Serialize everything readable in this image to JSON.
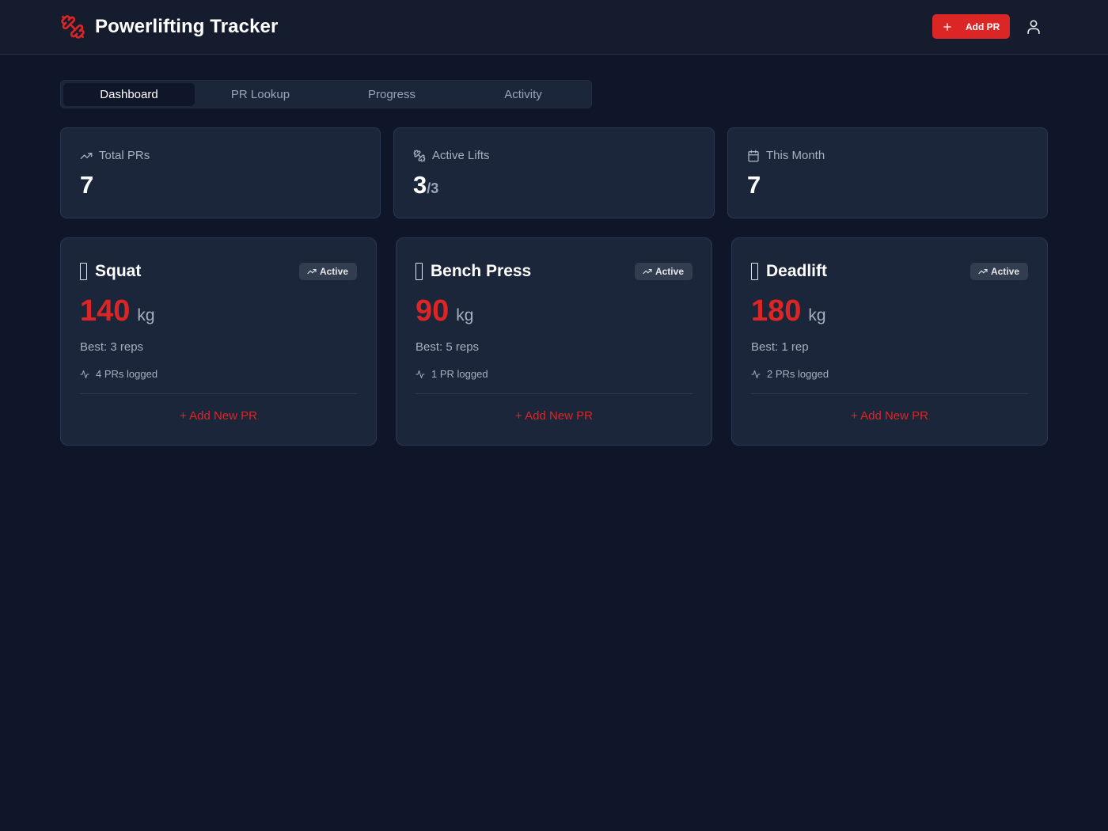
{
  "app": {
    "title": "Powerlifting Tracker",
    "add_pr_label": "Add PR",
    "accent_color": "#dc2626",
    "brand_icon": "dumbbell-icon",
    "user_icon": "user-icon"
  },
  "tabs": [
    {
      "label": "Dashboard",
      "active": true
    },
    {
      "label": "PR Lookup",
      "active": false
    },
    {
      "label": "Progress",
      "active": false
    },
    {
      "label": "Activity",
      "active": false
    }
  ],
  "stats": [
    {
      "label": "Total PRs",
      "value": "7",
      "sub": "",
      "icon": "trending-up-icon"
    },
    {
      "label": "Active Lifts",
      "value": "3",
      "sub": "/3",
      "icon": "dumbbell-icon"
    },
    {
      "label": "This Month",
      "value": "7",
      "sub": "",
      "icon": "calendar-icon"
    }
  ],
  "lifts": [
    {
      "name": "Squat",
      "status": "Active",
      "weight": "140",
      "unit": "kg",
      "best": "Best: 3 reps",
      "count": "4 PRs logged",
      "action": "+ Add New PR"
    },
    {
      "name": "Bench Press",
      "status": "Active",
      "weight": "90",
      "unit": "kg",
      "best": "Best: 5 reps",
      "count": "1 PR logged",
      "action": "+ Add New PR"
    },
    {
      "name": "Deadlift",
      "status": "Active",
      "weight": "180",
      "unit": "kg",
      "best": "Best: 1 rep",
      "count": "2 PRs logged",
      "action": "+ Add New PR"
    }
  ]
}
